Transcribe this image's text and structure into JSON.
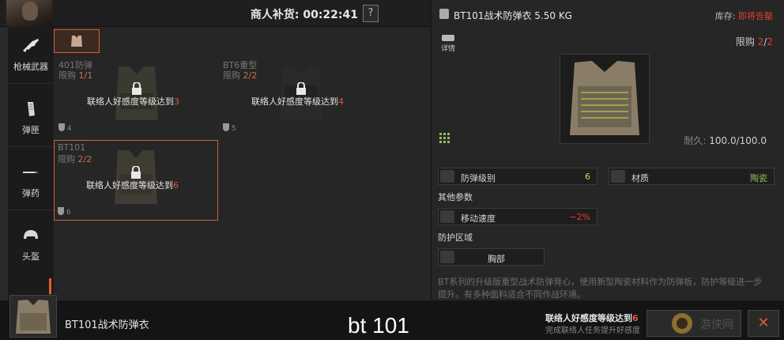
{
  "topbar": {
    "restock_label": "商人补货: 00:22:41",
    "help": "?"
  },
  "sidebar": {
    "items": [
      {
        "label": "枪械武器",
        "icon": "rifle-icon"
      },
      {
        "label": "弹匣",
        "icon": "magazine-icon"
      },
      {
        "label": "弹药",
        "icon": "bullet-icon"
      },
      {
        "label": "头盔",
        "icon": "helmet-icon"
      }
    ]
  },
  "items": [
    {
      "name": "401防弹",
      "limit_label": "限购 ",
      "limit": "1/1",
      "requirement": "联络人好感度等级达到",
      "level": "3",
      "armor": "4"
    },
    {
      "name": "BT6重型",
      "limit_label": "限购 ",
      "limit": "2/2",
      "requirement": "联络人好感度等级达到",
      "level": "4",
      "armor": "5"
    },
    {
      "name": "BT101",
      "limit_label": "限购 ",
      "limit": "2/2",
      "requirement": "联络人好感度等级达到",
      "level": "6",
      "armor": "6"
    }
  ],
  "panel": {
    "title": "BT101战术防弹衣 5.50 KG",
    "stock_label": "库存: ",
    "stock_status": "即将告罄",
    "limit_label": "限购 ",
    "limit_cur": "2",
    "limit_sep": "/",
    "limit_max": "2",
    "details": "详情",
    "durability_label": "耐久: ",
    "durability": "100.0/100.0",
    "stats": {
      "armor_label": "防弹级别",
      "armor_value": "6",
      "material_label": "材质",
      "material_value": "陶瓷",
      "other_params": "其他参数",
      "speed_label": "移动速度",
      "speed_value": "−2%",
      "protection_zone": "防护区域",
      "chest": "胸部"
    },
    "description": "BT系列的升级版重型战术防弹背心，使用新型陶瓷材料作为防弹板，防护等级进一步提升。有多种面料适合不同作战环境。"
  },
  "bottom": {
    "item_name": "BT101战术防弹衣",
    "subtitle": "bt 101",
    "requirement": "联络人好感度等级达到",
    "level": "6",
    "hint": "完成联络人任务提升好感度",
    "close": "✕",
    "watermark": "游侠网"
  },
  "colors": {
    "accent": "#d8612e",
    "warning": "#e0402d",
    "good": "#cbd45a",
    "material": "#8fbf5a"
  }
}
